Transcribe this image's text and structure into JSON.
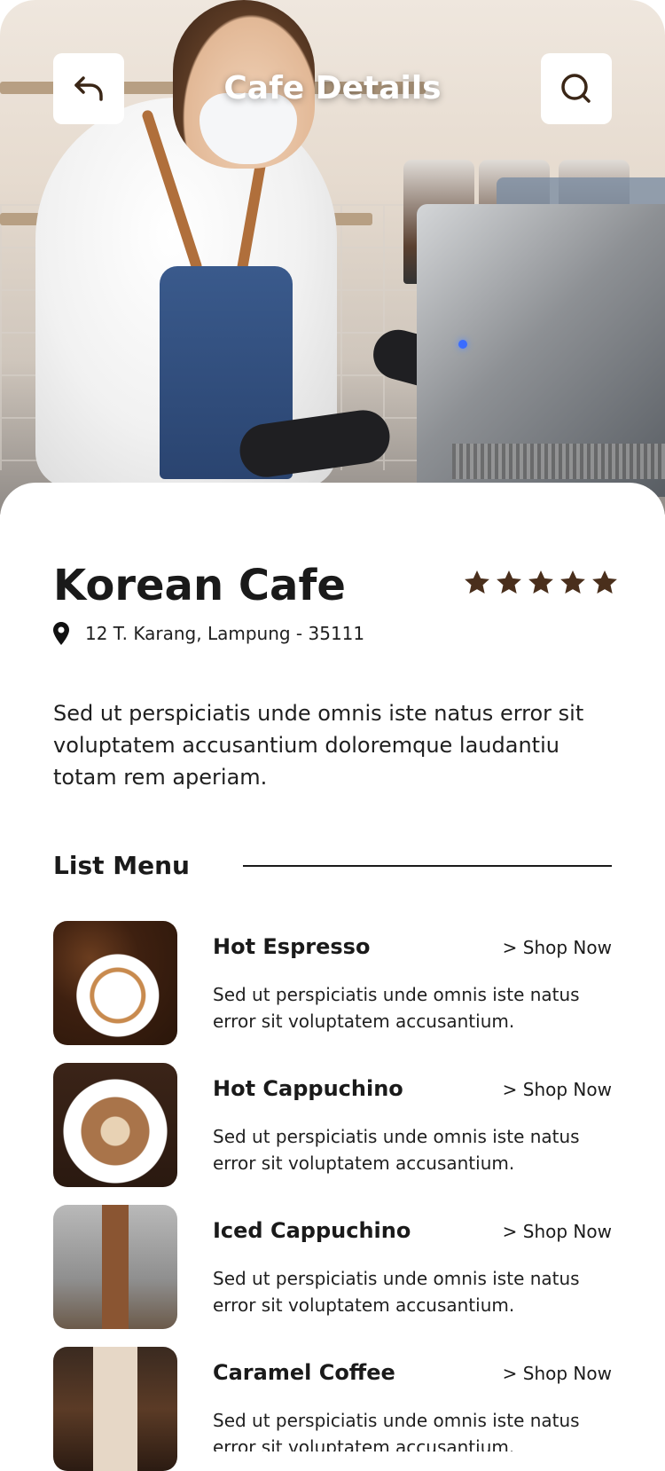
{
  "header": {
    "title": "Cafe Details"
  },
  "cafe": {
    "name": "Korean Cafe",
    "rating": 5,
    "rating_max": 5,
    "address": "12 T. Karang, Lampung - 35111",
    "description": "Sed ut perspiciatis unde omnis iste natus error sit voluptatem accusantium doloremque laudantiu totam rem aperiam."
  },
  "menu": {
    "title": "List Menu",
    "items": [
      {
        "name": "Hot Espresso",
        "action": "> Shop Now",
        "description": "Sed ut perspiciatis unde omnis iste natus error sit voluptatem accusantium."
      },
      {
        "name": "Hot Cappuchino",
        "action": "> Shop Now",
        "description": "Sed ut perspiciatis unde omnis iste natus error sit voluptatem accusantium."
      },
      {
        "name": "Iced Cappuchino",
        "action": "> Shop Now",
        "description": "Sed ut perspiciatis unde omnis iste natus error sit voluptatem accusantium."
      },
      {
        "name": "Caramel Coffee",
        "action": "> Shop Now",
        "description": "Sed ut perspiciatis unde omnis iste natus error sit voluptatem accusantium."
      }
    ]
  },
  "icons": {
    "back": "back-arrow-icon",
    "search": "search-icon",
    "star": "star-icon",
    "location": "location-pin-icon"
  },
  "colors": {
    "star": "#4a2f1c",
    "text": "#1a1a1a",
    "background": "#ffffff"
  }
}
